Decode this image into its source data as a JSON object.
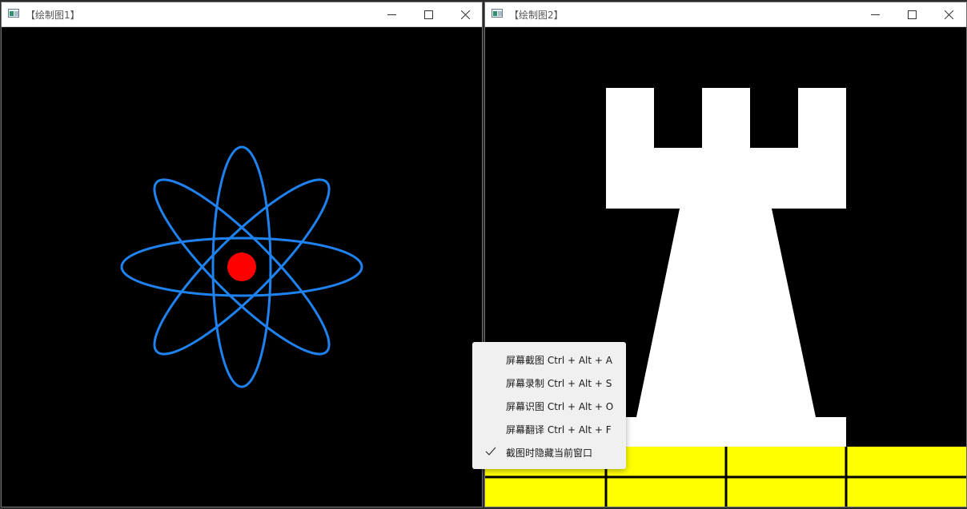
{
  "windows": [
    {
      "title": "【绘制图1】"
    },
    {
      "title": "【绘制图2】"
    }
  ],
  "menu": {
    "items": [
      {
        "label": "屏幕截图 Ctrl + Alt + A"
      },
      {
        "label": "屏幕录制 Ctrl + Alt + S"
      },
      {
        "label": "屏幕识图 Ctrl + Alt + O"
      },
      {
        "label": "屏幕翻译 Ctrl + Alt + F"
      },
      {
        "label": "截图时隐藏当前窗口",
        "checked": true
      }
    ]
  },
  "colors": {
    "orbit": "#1e82f0",
    "nucleus": "#ff0000",
    "rook": "#ffffff",
    "board_yellow": "#ffff00",
    "board_lines": "#000000",
    "canvas_background": "#000000"
  },
  "icons": [
    "app-icon",
    "minimize-icon",
    "maximize-icon",
    "close-icon",
    "check-icon"
  ]
}
